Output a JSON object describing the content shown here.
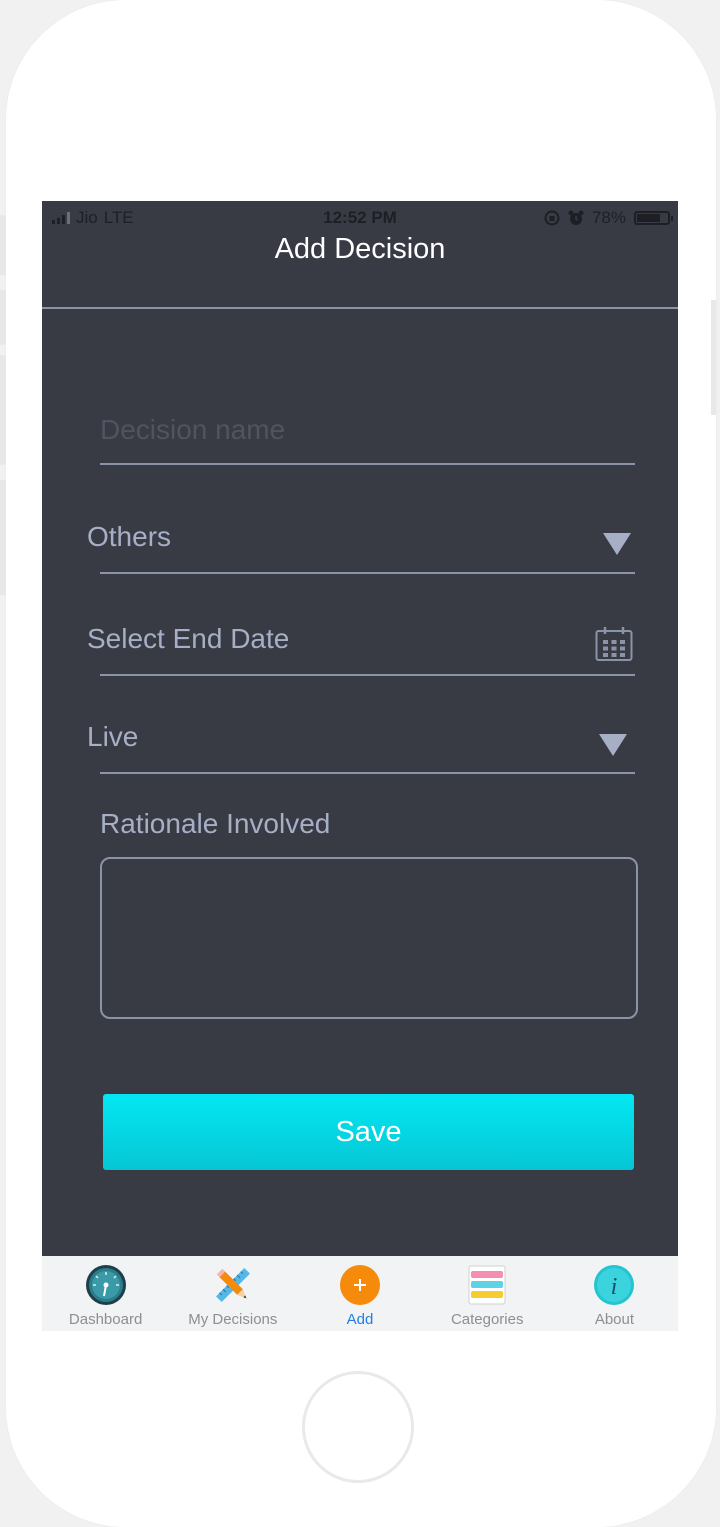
{
  "status_bar": {
    "carrier": "Jio",
    "network": "LTE",
    "time": "12:52 PM",
    "battery_percent": "78%",
    "battery_level": 0.78
  },
  "header": {
    "title": "Add Decision"
  },
  "form": {
    "decision_name": {
      "placeholder": "Decision name",
      "value": ""
    },
    "category": {
      "selected": "Others"
    },
    "end_date": {
      "text": "Select End Date"
    },
    "status": {
      "selected": "Live"
    },
    "rationale": {
      "label": "Rationale Involved",
      "value": ""
    },
    "save_label": "Save"
  },
  "tabbar": {
    "items": [
      {
        "label": "Dashboard",
        "icon": "dashboard-gauge-icon",
        "active": false
      },
      {
        "label": "My Decisions",
        "icon": "pencil-ruler-icon",
        "active": false
      },
      {
        "label": "Add",
        "icon": "add-plus-icon",
        "active": true
      },
      {
        "label": "Categories",
        "icon": "categories-stack-icon",
        "active": false
      },
      {
        "label": "About",
        "icon": "info-icon",
        "active": false
      }
    ]
  },
  "colors": {
    "background": "#383b44",
    "accent": "#04e7f4",
    "field_text": "#a7afc6",
    "divider": "#8b93a8",
    "active_tab": "#1e7ee6",
    "add_orange": "#f58a0b"
  }
}
